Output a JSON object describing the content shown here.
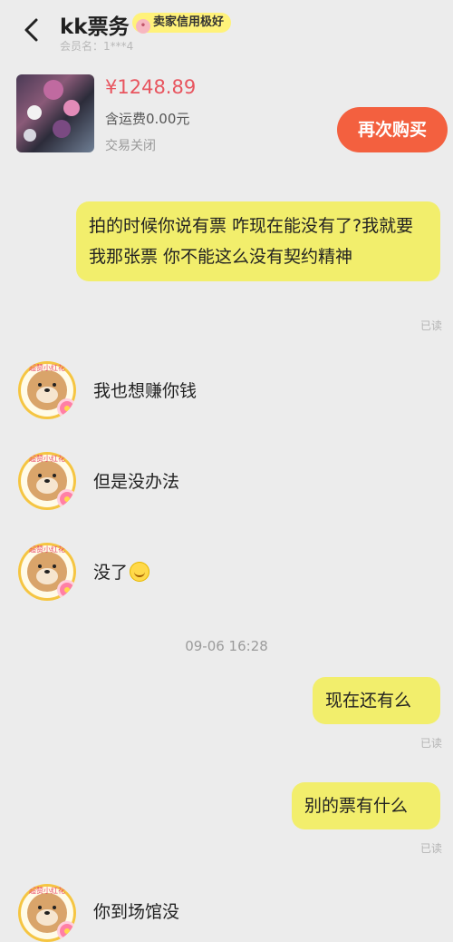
{
  "header": {
    "title": "kk票务",
    "badge": "卖家信用极好",
    "subtitle": "会员名：1***4"
  },
  "order": {
    "price": "¥1248.89",
    "shipping": "含运费0.00元",
    "status": "交易关闭",
    "rebuy_label": "再次购买"
  },
  "messages": {
    "m1": "拍的时候你说有票 咋现在能没有了?我就要我那张票 你不能这么没有契约精神",
    "m1_read": "已读",
    "m2": "我也想赚你钱",
    "m3": "但是没办法",
    "m4": "没了",
    "time": "09-06 16:28",
    "m5": "现在还有么",
    "m5_read": "已读",
    "m6": "别的票有什么",
    "m6_read": "已读",
    "m7": "你到场馆没"
  },
  "avatar_tag": "超赞小红花",
  "colors": {
    "background": "#ececec",
    "bubble_self": "#f2ee6c",
    "price": "#e8555f",
    "rebuy_button": "#f3603f",
    "badge": "#fff27a"
  },
  "icons": {
    "back": "chevron-left-icon",
    "emoji": "laughing-emoji-icon"
  }
}
